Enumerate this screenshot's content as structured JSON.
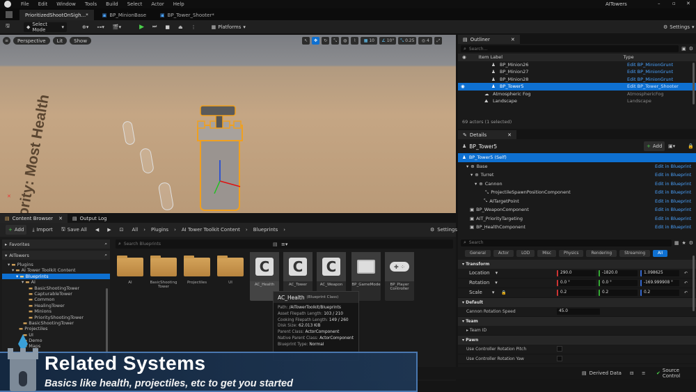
{
  "app": {
    "menu": [
      "File",
      "Edit",
      "Window",
      "Tools",
      "Build",
      "Select",
      "Actor",
      "Help"
    ],
    "project_name": "AITowers"
  },
  "tabs": [
    "PrioritizedShootOnSigh...*",
    "BP_MinionBase",
    "BP_Tower_Shooter*"
  ],
  "toolbar": {
    "select_mode": "Select Mode",
    "platforms": "Platforms",
    "settings": "Settings"
  },
  "viewport": {
    "perspective": "Perspective",
    "lit": "Lit",
    "show": "Show",
    "grid": "10",
    "angle": "10°",
    "scale": "0.25",
    "cams": "4",
    "wall_text": "...ority: Most Health"
  },
  "content_browser": {
    "tab": "Content Browser",
    "tab2": "Output Log",
    "add": "Add",
    "import": "Import",
    "save_all": "Save All",
    "breadcrumb": [
      "All",
      "Plugins",
      "AI Tower Toolkit Content",
      "Blueprints"
    ],
    "settings": "Settings",
    "favorites": "Favorites",
    "root": "AITowers",
    "search_placeholder": "Search Blueprints",
    "tree": [
      "Plugins",
      "AI Tower Toolkit Content",
      "Blueprints",
      "AI",
      "BasicShootingTower",
      "CapturableTower",
      "Common",
      "HealingTower",
      "Minions",
      "PriorityShootingTower",
      "BasicShootingTower",
      "Projectiles",
      "UI",
      "Demo",
      "Maps"
    ],
    "folders": [
      "AI",
      "BasicShooting Tower",
      "Projectiles",
      "UI"
    ],
    "assets": [
      "AC_Health",
      "AC_Tower",
      "AC_Weapon",
      "BP_GameMode",
      "BP_Player Controller"
    ]
  },
  "tooltip": {
    "title": "AC_Health",
    "subtitle": "(Blueprint Class)",
    "rows": [
      [
        "Path:",
        "/AITowerToolkit/Blueprints"
      ],
      [
        "Asset Filepath Length:",
        "103 / 210"
      ],
      [
        "Cooking Filepath Length:",
        "149 / 260"
      ],
      [
        "Disk Size:",
        "62.013 KiB"
      ],
      [
        "Parent Class:",
        "ActorComponent"
      ],
      [
        "Native Parent Class:",
        "ActorComponent"
      ],
      [
        "Blueprint Type:",
        "Normal"
      ]
    ]
  },
  "outliner": {
    "title": "Outliner",
    "search": "Search...",
    "col_label": "Item Label",
    "col_type": "Type",
    "rows": [
      {
        "label": "BP_Minion26",
        "type": "Edit BP_MinionGrunt",
        "link": true
      },
      {
        "label": "BP_Minion27",
        "type": "Edit BP_MinionGrunt",
        "link": true
      },
      {
        "label": "BP_Minion28",
        "type": "Edit BP_MinionGrunt",
        "link": true
      },
      {
        "label": "BP_Tower5",
        "type": "Edit BP_Tower_Shooter",
        "link": true,
        "selected": true
      },
      {
        "label": "Atmospheric Fog",
        "type": "AtmosphericFog",
        "link": false
      },
      {
        "label": "Landscape",
        "type": "Landscape",
        "link": false
      }
    ],
    "footer": "69 actors (1 selected)"
  },
  "details": {
    "title": "Details",
    "object": "BP_Tower5",
    "add": "Add",
    "self": "BP_Tower5 (Self)",
    "components": [
      {
        "name": "Base",
        "link": "Edit in Blueprint",
        "indent": 1
      },
      {
        "name": "Turret",
        "link": "Edit in Blueprint",
        "indent": 2
      },
      {
        "name": "Cannon",
        "link": "Edit in Blueprint",
        "indent": 3
      },
      {
        "name": "ProjectileSpawnPositionComponent",
        "link": "Edit in Blueprint",
        "indent": 4
      },
      {
        "name": "AITargetPoint",
        "link": "Edit in Blueprint",
        "indent": 2
      },
      {
        "name": "BP_WeaponComponent",
        "link": "Edit in Blueprint",
        "indent": 1
      },
      {
        "name": "AIT_PriorityTargeting",
        "link": "Edit in Blueprint",
        "indent": 1
      },
      {
        "name": "BP_HealthComponent",
        "link": "Edit in Blueprint",
        "indent": 1
      }
    ],
    "search": "Search",
    "filters": [
      "General",
      "Actor",
      "LOD",
      "Misc",
      "Physics",
      "Rendering",
      "Streaming",
      "All"
    ],
    "transform": "Transform",
    "location": {
      "label": "Location",
      "x": "290.0",
      "y": "-1820.0",
      "z": "1.098625"
    },
    "rotation": {
      "label": "Rotation",
      "x": "0.0 °",
      "y": "0.0 °",
      "z": "-169.999908 °"
    },
    "scale": {
      "label": "Scale",
      "x": "0.2",
      "y": "0.2",
      "z": "0.2"
    },
    "default": "Default",
    "cannon_speed_label": "Cannon Rotation Speed",
    "cannon_speed": "45.0",
    "team": "Team",
    "team_id": "Team ID",
    "pawn": "Pawn",
    "pitch": "Use Controller Rotation Pitch",
    "yaw": "Use Controller Rotation Yaw"
  },
  "status": {
    "derived": "Derived Data",
    "source": "Source Control"
  },
  "banner": {
    "title": "Related Systems",
    "subtitle": "Basics like health, projectiles, etc to get you started"
  }
}
